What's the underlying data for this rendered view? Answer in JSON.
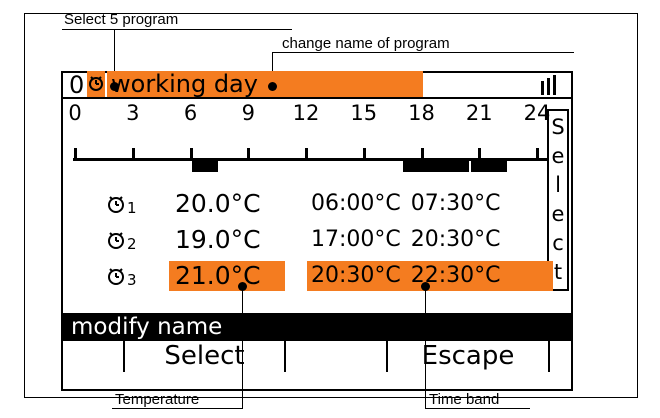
{
  "callouts": {
    "select_program": "Select 5 program",
    "change_name": "change name of program",
    "temperature": "Temperature",
    "time_band": "Time band"
  },
  "header": {
    "program_number": "0",
    "program_name": "working day",
    "signal_icon": "signal-bars-icon",
    "clock_icon": "clock-icon"
  },
  "timeline": {
    "ticks": [
      "0",
      "3",
      "6",
      "9",
      "12",
      "15",
      "18",
      "21",
      "24"
    ],
    "bands": [
      {
        "start": 6.0,
        "end": 7.5
      },
      {
        "start": 17.0,
        "end": 20.5
      },
      {
        "start": 20.5,
        "end": 22.5
      }
    ]
  },
  "rows": [
    {
      "index": "1",
      "temperature": "20.0°C",
      "start": "06:00°C",
      "end": "07:30°C",
      "highlighted": false
    },
    {
      "index": "2",
      "temperature": "19.0°C",
      "start": "17:00°C",
      "end": "20:30°C",
      "highlighted": false
    },
    {
      "index": "3",
      "temperature": "21.0°C",
      "start": "20:30°C",
      "end": "22:30°C",
      "highlighted": true
    }
  ],
  "side_label": "Select",
  "status_bar": "modify name",
  "softkeys": {
    "left": "Select",
    "right": "Escape"
  },
  "colors": {
    "highlight": "#f47c20",
    "ink": "#000000",
    "background": "#ffffff"
  }
}
